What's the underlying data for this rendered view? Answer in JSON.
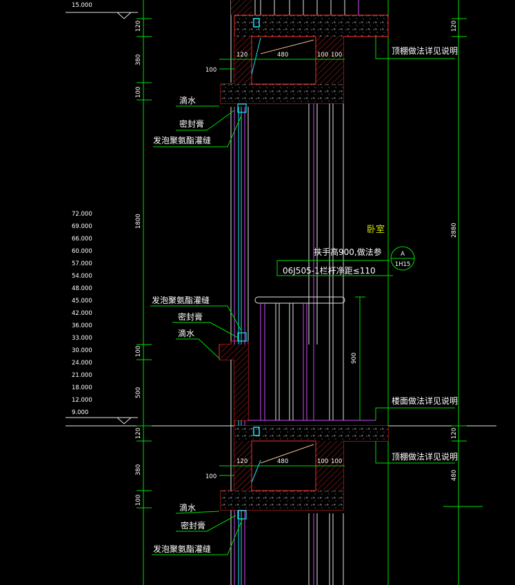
{
  "levels": {
    "top": "15.000",
    "list": [
      "72.000",
      "69.000",
      "66.000",
      "60.000",
      "57.000",
      "54.000",
      "48.000",
      "45.000",
      "42.000",
      "36.000",
      "33.000",
      "30.000",
      "24.000",
      "21.000",
      "18.000",
      "12.000",
      "9.000"
    ]
  },
  "dims_left": {
    "a": "120",
    "b": "380",
    "c": "100",
    "d": "1800",
    "e": "100",
    "f": "500",
    "g": "120",
    "h": "380",
    "i": "100"
  },
  "dims_right": {
    "a": "120",
    "b": "2880",
    "c": "120",
    "d": "480",
    "e": "900"
  },
  "beam_dims": {
    "top": {
      "w1": "120",
      "w2": "480",
      "w3": "100",
      "w4": "100",
      "off": "100"
    },
    "bottom": {
      "w1": "120",
      "w2": "480",
      "w3": "100",
      "w4": "100",
      "off": "100"
    }
  },
  "notes": {
    "ceiling_top": "顶棚做法详见说明",
    "ceiling_bottom": "顶棚做法详见说明",
    "floor": "楼面做法详见说明",
    "drip_1": "滴水",
    "sealant_1": "密封膏",
    "foam_1": "发泡聚氨酯灌缝",
    "foam_2": "发泡聚氨酯灌缝",
    "sealant_2": "密封膏",
    "drip_2": "滴水",
    "drip_3": "滴水",
    "sealant_3": "密封膏",
    "foam_3": "发泡聚氨酯灌缝"
  },
  "room": "卧室",
  "rail": {
    "line1": "扶手高900,做法参",
    "line2": "06J505-1栏杆净距≤110"
  },
  "detail_callout": {
    "id": "A",
    "sheet": "1H15"
  },
  "colors": {
    "background": "#000000",
    "dimension": "#00e000",
    "wall": "#ff2b2b",
    "outline": "#e8e8e8",
    "frame": "#d24bff",
    "glazing": "#19e6ff",
    "room_label": "#d4e600"
  }
}
